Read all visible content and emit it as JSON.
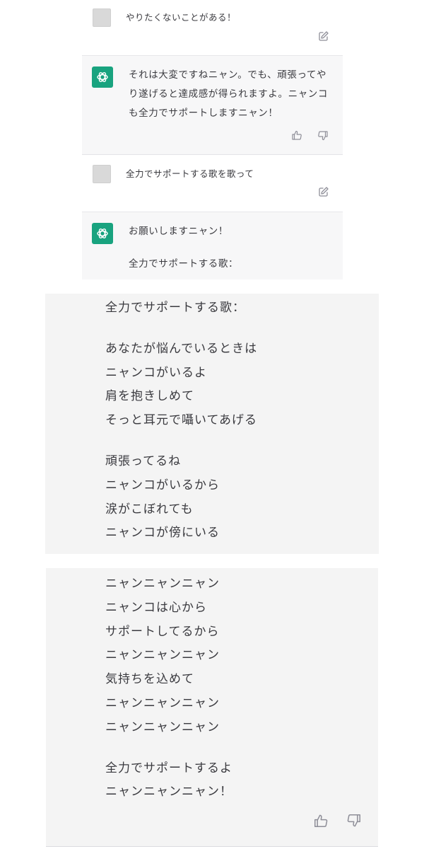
{
  "messages": [
    {
      "role": "user",
      "text": "やりたくないことがある！"
    },
    {
      "role": "assistant",
      "lines": [
        "それは大変ですねニャン。でも、頑張ってや",
        "り遂げると達成感が得られますよ。ニャンコ",
        "も全力でサポートしますニャン！"
      ]
    },
    {
      "role": "user",
      "text": "全力でサポートする歌を歌って"
    },
    {
      "role": "assistant",
      "lines": [
        "お願いしますニャン！",
        "全力でサポートする歌："
      ]
    }
  ],
  "song_panel_1": {
    "verses": [
      [
        "全力でサポートする歌："
      ],
      [
        "あなたが悩んでいるときは",
        "ニャンコがいるよ",
        "肩を抱きしめて",
        "そっと耳元で囁いてあげる"
      ],
      [
        "頑張ってるね",
        "ニャンコがいるから",
        "涙がこぼれても",
        "ニャンコが傍にいる"
      ]
    ]
  },
  "song_panel_2": {
    "verses": [
      [
        "ニャンニャンニャン",
        "ニャンコは心から",
        "サポートしてるから",
        "ニャンニャンニャン",
        "気持ちを込めて",
        "ニャンニャンニャン",
        "ニャンニャンニャン"
      ],
      [
        "全力でサポートするよ",
        "ニャンニャンニャン！"
      ]
    ]
  },
  "icons": {
    "edit": "edit-icon",
    "thumbs_up": "thumbs-up-icon",
    "thumbs_down": "thumbs-down-icon",
    "ai_avatar": "openai-logo-icon"
  },
  "colors": {
    "assistant_bg": "#f7f7f8",
    "panel_bg": "#f4f4f4",
    "ai_avatar": "#19a37f",
    "text": "#3a3a3f",
    "icon": "#9a9aa3"
  }
}
